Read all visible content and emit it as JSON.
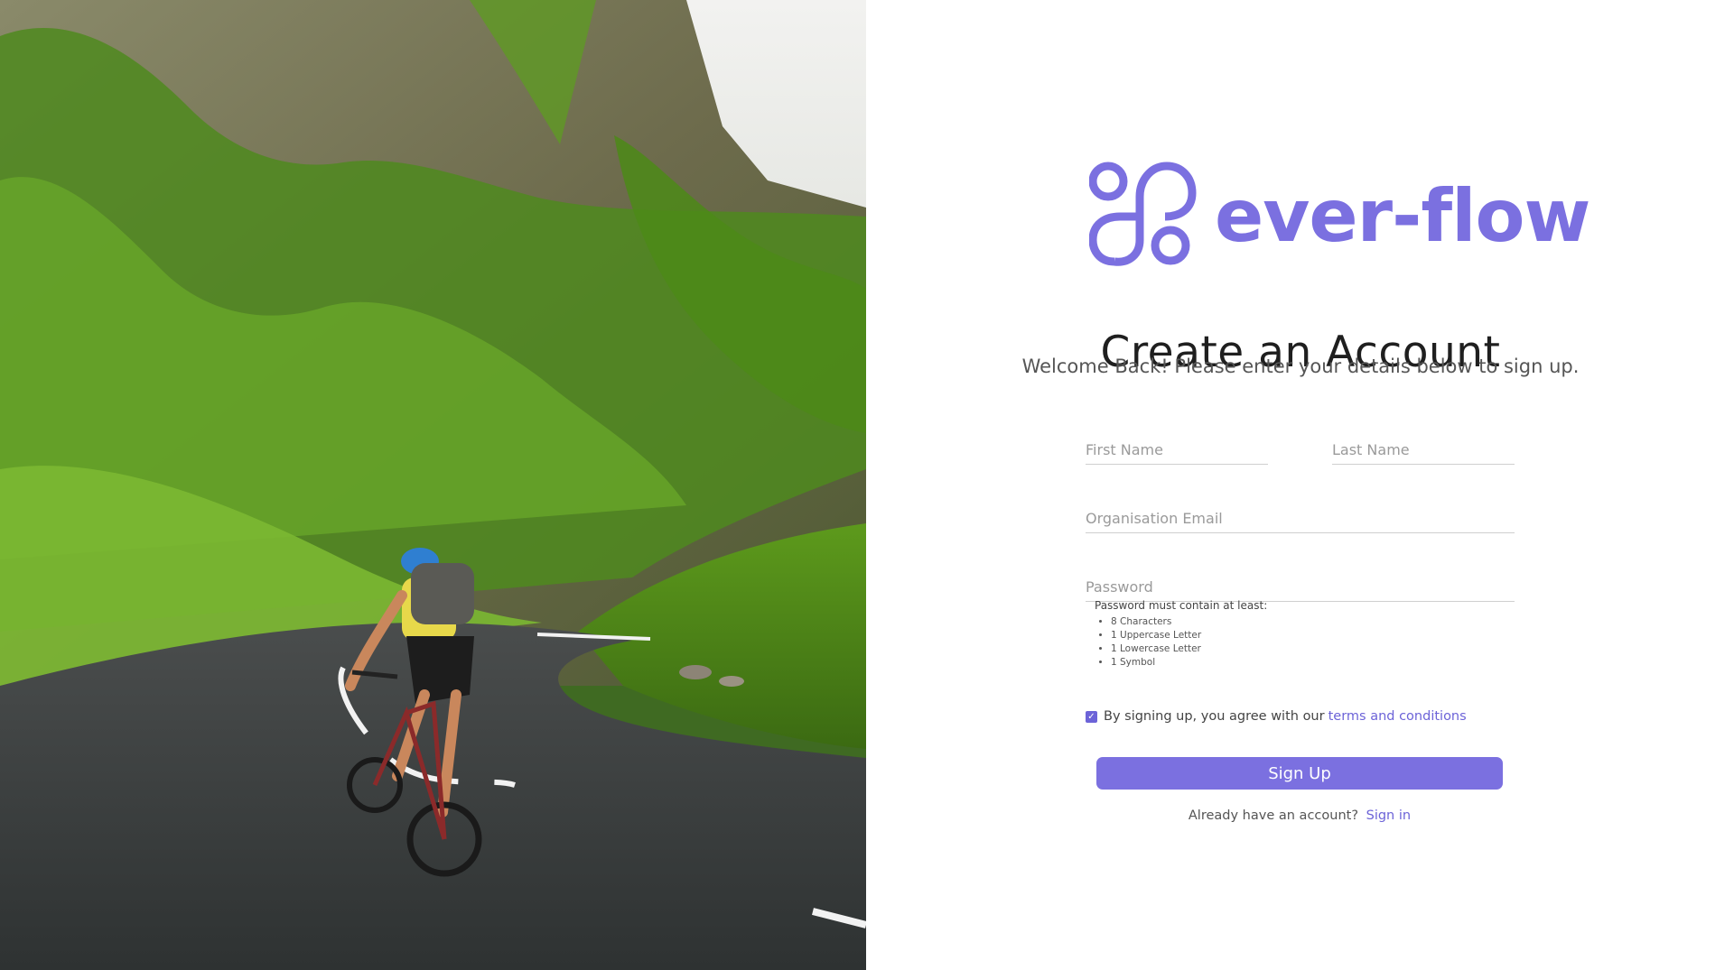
{
  "brand": {
    "name": "ever-flow",
    "accent_color": "#7b70e0"
  },
  "heading": {
    "title": "Create an Account",
    "subtitle": "Welcome Back! Please enter your details below to sign up."
  },
  "form": {
    "first_name_placeholder": "First Name",
    "last_name_placeholder": "Last Name",
    "email_placeholder": "Organisation Email",
    "password_placeholder": "Password",
    "password_rules_title": "Password must contain at least:",
    "password_rules": [
      "8 Characters",
      "1 Uppercase Letter",
      "1 Lowercase Letter",
      "1 Symbol"
    ],
    "agree_text": "By signing up, you agree with our",
    "agree_link": "terms and conditions",
    "agree_checked": true,
    "submit_label": "Sign Up",
    "signin_prompt": "Already have an account?",
    "signin_link": "Sign in"
  },
  "hero_image": {
    "icon": "cyclist-photo"
  }
}
